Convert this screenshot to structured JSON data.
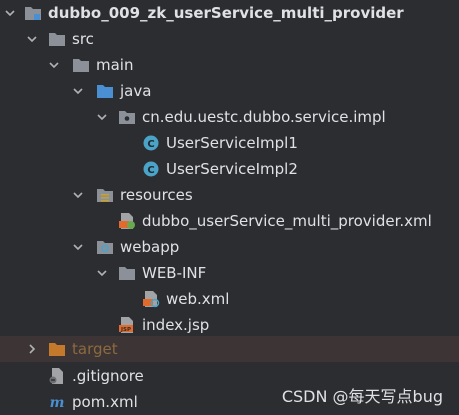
{
  "tree": {
    "project": "dubbo_009_zk_userService_multi_provider",
    "src": "src",
    "main": "main",
    "java": "java",
    "package": "cn.edu.uestc.dubbo.service.impl",
    "class1": "UserServiceImpl1",
    "class2": "UserServiceImpl2",
    "resources": "resources",
    "provider_xml": "dubbo_userService_multi_provider.xml",
    "webapp": "webapp",
    "web_inf": "WEB-INF",
    "web_xml": "web.xml",
    "index_jsp": "index.jsp",
    "target": "target",
    "gitignore": ".gitignore",
    "pom": "pom.xml"
  },
  "watermark": "CSDN @每天写点bug",
  "colors": {
    "background": "#2b2d30",
    "folder": "#8c9099",
    "source_folder": "#4a8fd1",
    "excluded_folder": "#c47a2a",
    "class_icon": "#4ba3c7",
    "xml_icon": "#e06b2c"
  }
}
